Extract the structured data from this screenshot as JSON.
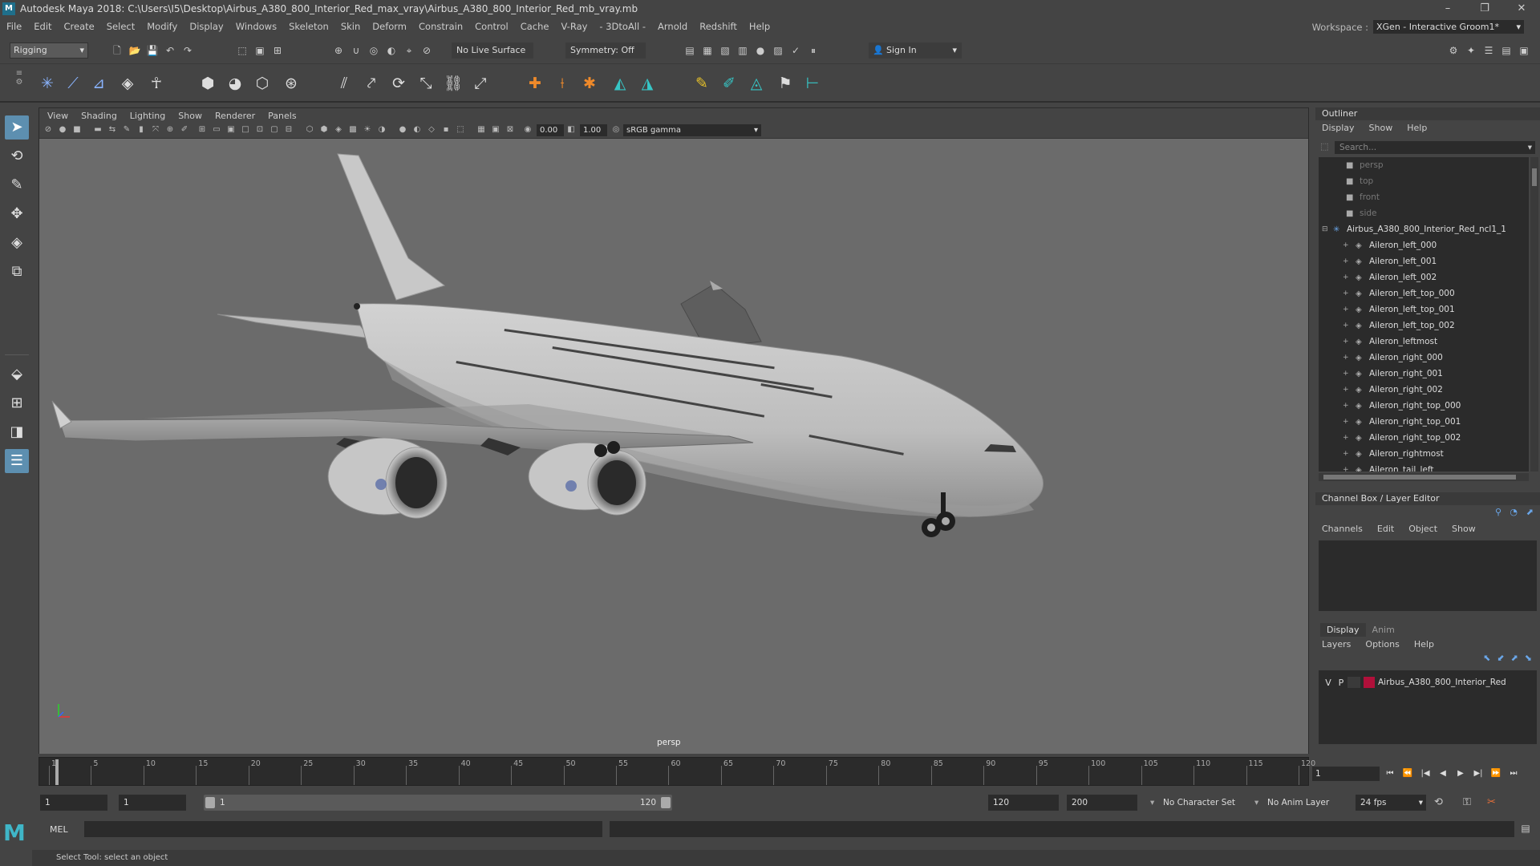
{
  "window": {
    "title": "Autodesk Maya 2018: C:\\Users\\I5\\Desktop\\Airbus_A380_800_Interior_Red_max_vray\\Airbus_A380_800_Interior_Red_mb_vray.mb",
    "app_icon": "M",
    "controls": [
      "–",
      "❐",
      "✕"
    ]
  },
  "menubar": {
    "items": [
      "File",
      "Edit",
      "Create",
      "Select",
      "Modify",
      "Display",
      "Windows",
      "Skeleton",
      "Skin",
      "Deform",
      "Constrain",
      "Control",
      "Cache",
      "V-Ray",
      "- 3DtoAll -",
      "Arnold",
      "Redshift",
      "Help"
    ],
    "workspace_label": "Workspace :",
    "workspace_value": "XGen - Interactive Groom1*"
  },
  "statusline": {
    "mode": "Rigging",
    "live_surface": "No Live Surface",
    "symmetry": "Symmetry: Off",
    "sign_in": "Sign In"
  },
  "viewport": {
    "menu": [
      "View",
      "Shading",
      "Lighting",
      "Show",
      "Renderer",
      "Panels"
    ],
    "exposure": "0.00",
    "gamma_value": "1.00",
    "color_space": "sRGB gamma",
    "camera_label": "persp",
    "model_color": "#c4c4c4",
    "background_color": "#6b6b6b"
  },
  "outliner": {
    "title": "Outliner",
    "menu": [
      "Display",
      "Show",
      "Help"
    ],
    "search_placeholder": "Search...",
    "cameras": [
      "persp",
      "top",
      "front",
      "side"
    ],
    "group": "Airbus_A380_800_Interior_Red_ncl1_1",
    "children": [
      "Aileron_left_000",
      "Aileron_left_001",
      "Aileron_left_002",
      "Aileron_left_top_000",
      "Aileron_left_top_001",
      "Aileron_left_top_002",
      "Aileron_leftmost",
      "Aileron_right_000",
      "Aileron_right_001",
      "Aileron_right_002",
      "Aileron_right_top_000",
      "Aileron_right_top_001",
      "Aileron_right_top_002",
      "Aileron_rightmost",
      "Aileron_tail_left"
    ]
  },
  "channelbox": {
    "title": "Channel Box / Layer Editor",
    "menu": [
      "Channels",
      "Edit",
      "Object",
      "Show"
    ]
  },
  "layereditor": {
    "tabs": [
      "Display",
      "Anim"
    ],
    "menu": [
      "Layers",
      "Options",
      "Help"
    ],
    "layer": {
      "v": "V",
      "p": "P",
      "name": "Airbus_A380_800_Interior_Red",
      "color": "#b0103a"
    }
  },
  "timeslider": {
    "labels": [
      "1",
      "5",
      "10",
      "15",
      "20",
      "25",
      "30",
      "35",
      "40",
      "45",
      "50",
      "55",
      "60",
      "65",
      "70",
      "75",
      "80",
      "85",
      "90",
      "95",
      "100",
      "105",
      "110",
      "115",
      "120"
    ],
    "current_frame": "1"
  },
  "playback": {
    "buttons": [
      "⏮",
      "⏪",
      "|◀",
      "◀",
      "▶",
      "▶|",
      "⏩",
      "⏭"
    ]
  },
  "rangeslider": {
    "start": "1",
    "playback_start": "1",
    "range_start": "1",
    "range_end": "120",
    "playback_end": "120",
    "end": "200",
    "character_set": "No Character Set",
    "anim_layer": "No Anim Layer",
    "fps": "24 fps"
  },
  "cmdline": {
    "lang": "MEL",
    "logo": "M"
  },
  "helpline": {
    "text": "Select Tool: select an object"
  }
}
